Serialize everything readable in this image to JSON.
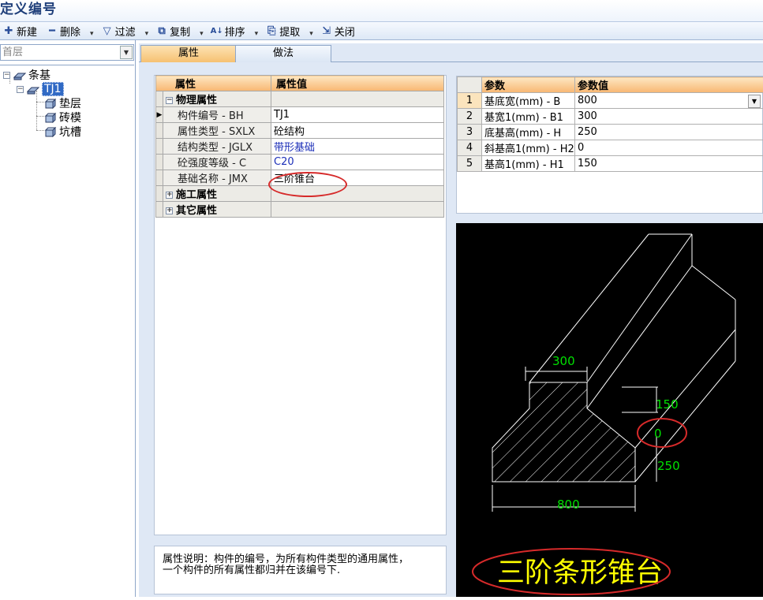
{
  "window": {
    "title": "定义编号"
  },
  "toolbar": {
    "new": "新建",
    "delete": "删除",
    "filter": "过滤",
    "copy": "复制",
    "sort": "排序",
    "extract": "提取",
    "close": "关闭"
  },
  "floor": {
    "value": "首层"
  },
  "tree": {
    "root": "条基",
    "selected": "TJ1",
    "children": [
      "垫层",
      "砖模",
      "坑槽"
    ]
  },
  "tabs": {
    "properties": "属性",
    "method": "做法"
  },
  "props": {
    "header_name": "属性",
    "header_value": "属性值",
    "group_physical": "物理属性",
    "rows": [
      {
        "name": "构件编号 - BH",
        "value": "TJ1"
      },
      {
        "name": "属性类型 - SXLX",
        "value": "砼结构"
      },
      {
        "name": "结构类型 - JGLX",
        "value": "带形基础"
      },
      {
        "name": "砼强度等级 - C",
        "value": "C20"
      },
      {
        "name": "基础名称 - JMX",
        "value": "三阶锥台"
      }
    ],
    "group_construction": "施工属性",
    "group_other": "其它属性"
  },
  "description": {
    "line1": "属性说明：构件的编号，为所有构件类型的通用属性，",
    "line2": "一个构件的所有属性都归并在该编号下."
  },
  "params": {
    "header_name": "参数",
    "header_value": "参数值",
    "rows": [
      {
        "idx": "1",
        "name": "基底宽(mm) - B",
        "value": "800"
      },
      {
        "idx": "2",
        "name": "基宽1(mm) - B1",
        "value": "300"
      },
      {
        "idx": "3",
        "name": "底基高(mm) - H",
        "value": "250"
      },
      {
        "idx": "4",
        "name": "斜基高1(mm) - H2",
        "value": "0"
      },
      {
        "idx": "5",
        "name": "基高1(mm) - H1",
        "value": "150"
      }
    ]
  },
  "preview": {
    "dim_b1": "300",
    "dim_h1": "150",
    "dim_h2": "0",
    "dim_h": "250",
    "dim_b": "800",
    "caption": "三阶条形锥台",
    "line_color": "#ffffff",
    "dim_color": "#00e000",
    "caption_color": "#ffff00"
  },
  "colors": {
    "header_orange": "#f8b772",
    "selection_blue": "#316ac5",
    "annotation_red": "#d62a2a"
  }
}
